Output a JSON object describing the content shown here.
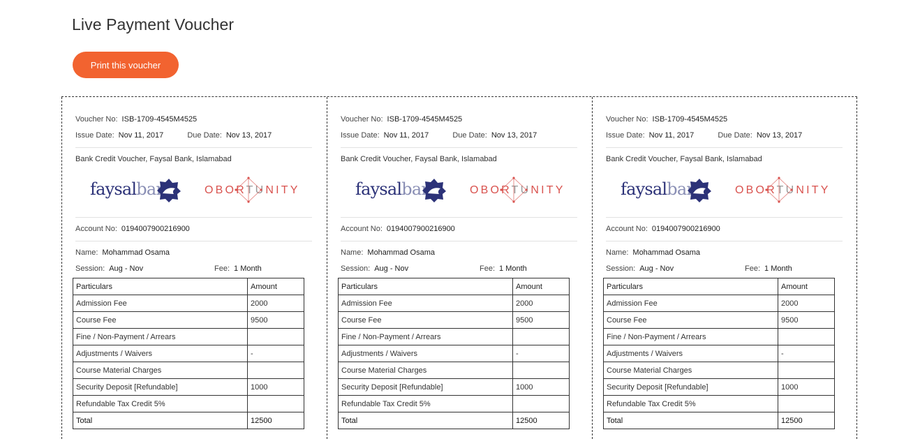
{
  "page": {
    "title": "Live Payment Voucher",
    "print_button": "Print this voucher"
  },
  "voucher": {
    "voucher_no_label": "Voucher No:",
    "voucher_no": "ISB-1709-4545M4525",
    "issue_date_label": "Issue Date:",
    "issue_date": "Nov 11, 2017",
    "due_date_label": "Due Date:",
    "due_date": "Nov 13, 2017",
    "bank_line": "Bank Credit Voucher, Faysal Bank, Islamabad",
    "logos": {
      "bank": "faysalbank",
      "institute": "OBORTUNITY",
      "bank_color": "#2c3278",
      "institute_color": "#d9534f"
    },
    "account_label": "Account No:",
    "account_no": "0194007900216900",
    "name_label": "Name:",
    "name": "Mohammad Osama",
    "session_label": "Session:",
    "session": "Aug - Nov",
    "fee_label": "Fee:",
    "fee": "1 Month",
    "table": {
      "headers": [
        "Particulars",
        "Amount"
      ],
      "rows": [
        [
          "Admission Fee",
          "2000"
        ],
        [
          "Course Fee",
          "9500"
        ],
        [
          "Fine / Non-Payment / Arrears",
          ""
        ],
        [
          "Adjustments / Waivers",
          "-"
        ],
        [
          "Course Material Charges",
          ""
        ],
        [
          "Security Deposit [Refundable]",
          "1000"
        ],
        [
          "Refundable Tax Credit 5%",
          ""
        ]
      ],
      "total_label": "Total",
      "total": "12500"
    }
  },
  "colors": {
    "accent": "#f26330"
  }
}
